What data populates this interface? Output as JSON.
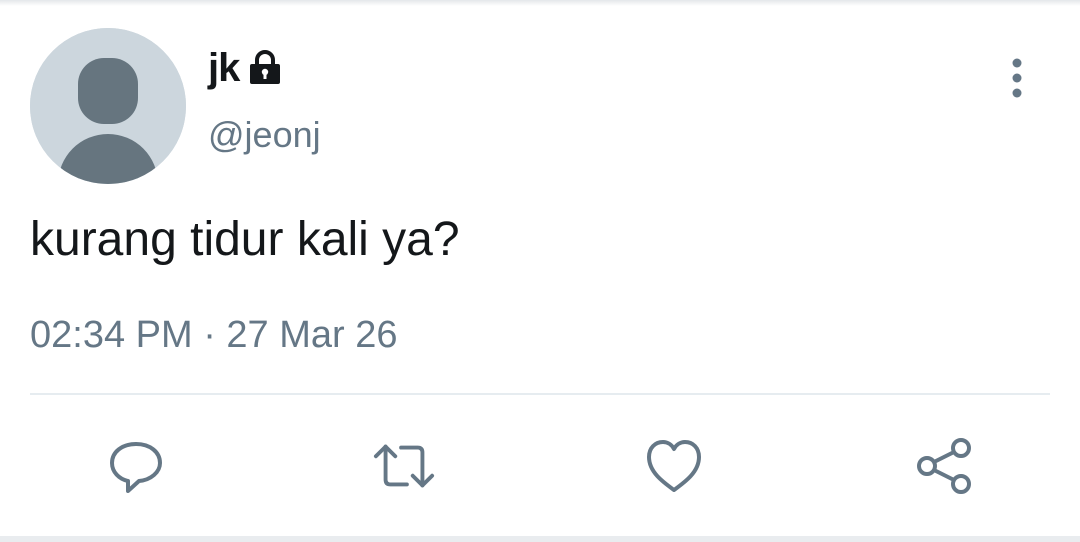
{
  "tweet": {
    "display_name": "jk",
    "handle": "@jeonj",
    "protected": true,
    "text": "kurang tidur kali ya?",
    "timestamp": "02:34 PM · 27 Mar 26"
  },
  "icons": {
    "lock": "lock-icon",
    "more": "more-vertical-icon",
    "reply": "reply-icon",
    "retweet": "retweet-icon",
    "like": "heart-icon",
    "share": "share-icon"
  },
  "colors": {
    "primary_text": "#14171a",
    "secondary_text": "#657786",
    "avatar_bg": "#ccd6dd",
    "avatar_figure": "#66757f",
    "divider": "#e6ecf0"
  }
}
